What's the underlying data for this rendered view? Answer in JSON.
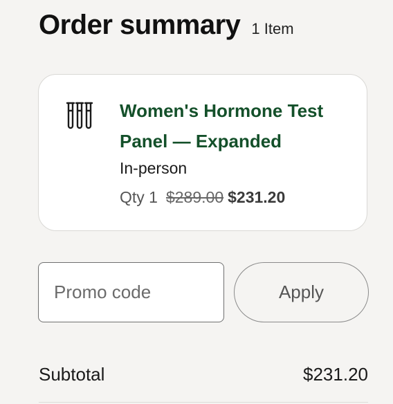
{
  "order_summary": {
    "title": "Order summary",
    "item_count": "1 Item"
  },
  "item": {
    "icon": "test-tubes-icon",
    "name": "Women's Hormone Test Panel — Expanded",
    "mode": "In-person",
    "qty_label": "Qty 1",
    "original_price": "$289.00",
    "sale_price": "$231.20"
  },
  "promo": {
    "placeholder": "Promo code",
    "value": "",
    "apply_label": "Apply"
  },
  "totals": {
    "subtotal_label": "Subtotal",
    "subtotal_value": "$231.20"
  },
  "colors": {
    "product_name": "#14502a",
    "background": "#f5f4f2"
  }
}
